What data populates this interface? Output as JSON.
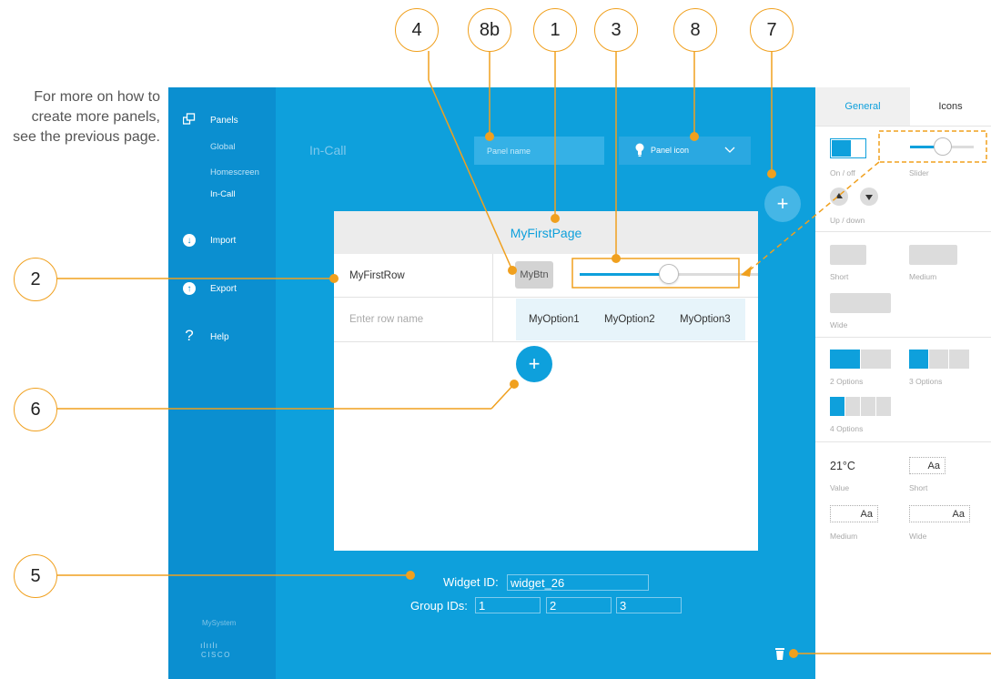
{
  "side_note": "For more on how to create more panels, see the previous page.",
  "sidebar": {
    "panels": "Panels",
    "global": "Global",
    "homescreen": "Homescreen",
    "in_call": "In-Call",
    "import": "Import",
    "export": "Export",
    "help": "Help",
    "help_symbol": "?",
    "system": "MySystem",
    "logo_bars": "ılıılı",
    "logo_word": "CISCO"
  },
  "header": {
    "panel_type": "In-Call",
    "panel_name_placeholder": "Panel name",
    "panel_icon": "Panel icon"
  },
  "page": {
    "title": "MyFirstPage",
    "row1_name": "MyFirstRow",
    "row2_placeholder": "Enter row name",
    "button_label": "MyBtn",
    "slider_level": 0.5,
    "options": [
      "MyOption1",
      "MyOption2",
      "MyOption3"
    ],
    "add_symbol": "+"
  },
  "widget": {
    "id_label": "Widget ID:",
    "id_value": "widget_26",
    "group_label": "Group IDs:",
    "groups": [
      "1",
      "2",
      "3"
    ]
  },
  "right_panel": {
    "tab_general": "General",
    "tab_icons": "Icons",
    "on_off": "On / off",
    "slider": "Slider",
    "up_down": "Up / down",
    "short": "Short",
    "medium": "Medium",
    "wide": "Wide",
    "opt2": "2 Options",
    "opt3": "3 Options",
    "opt4": "4 Options",
    "value_sample": "21°C",
    "value": "Value",
    "text_sample": "Aa"
  },
  "callouts": [
    "4",
    "8b",
    "1",
    "3",
    "8",
    "7",
    "2",
    "6",
    "5"
  ],
  "colors": {
    "accent": "#0ea0dc",
    "sidebar": "#0b8fd0",
    "callout": "#f0a01e"
  }
}
